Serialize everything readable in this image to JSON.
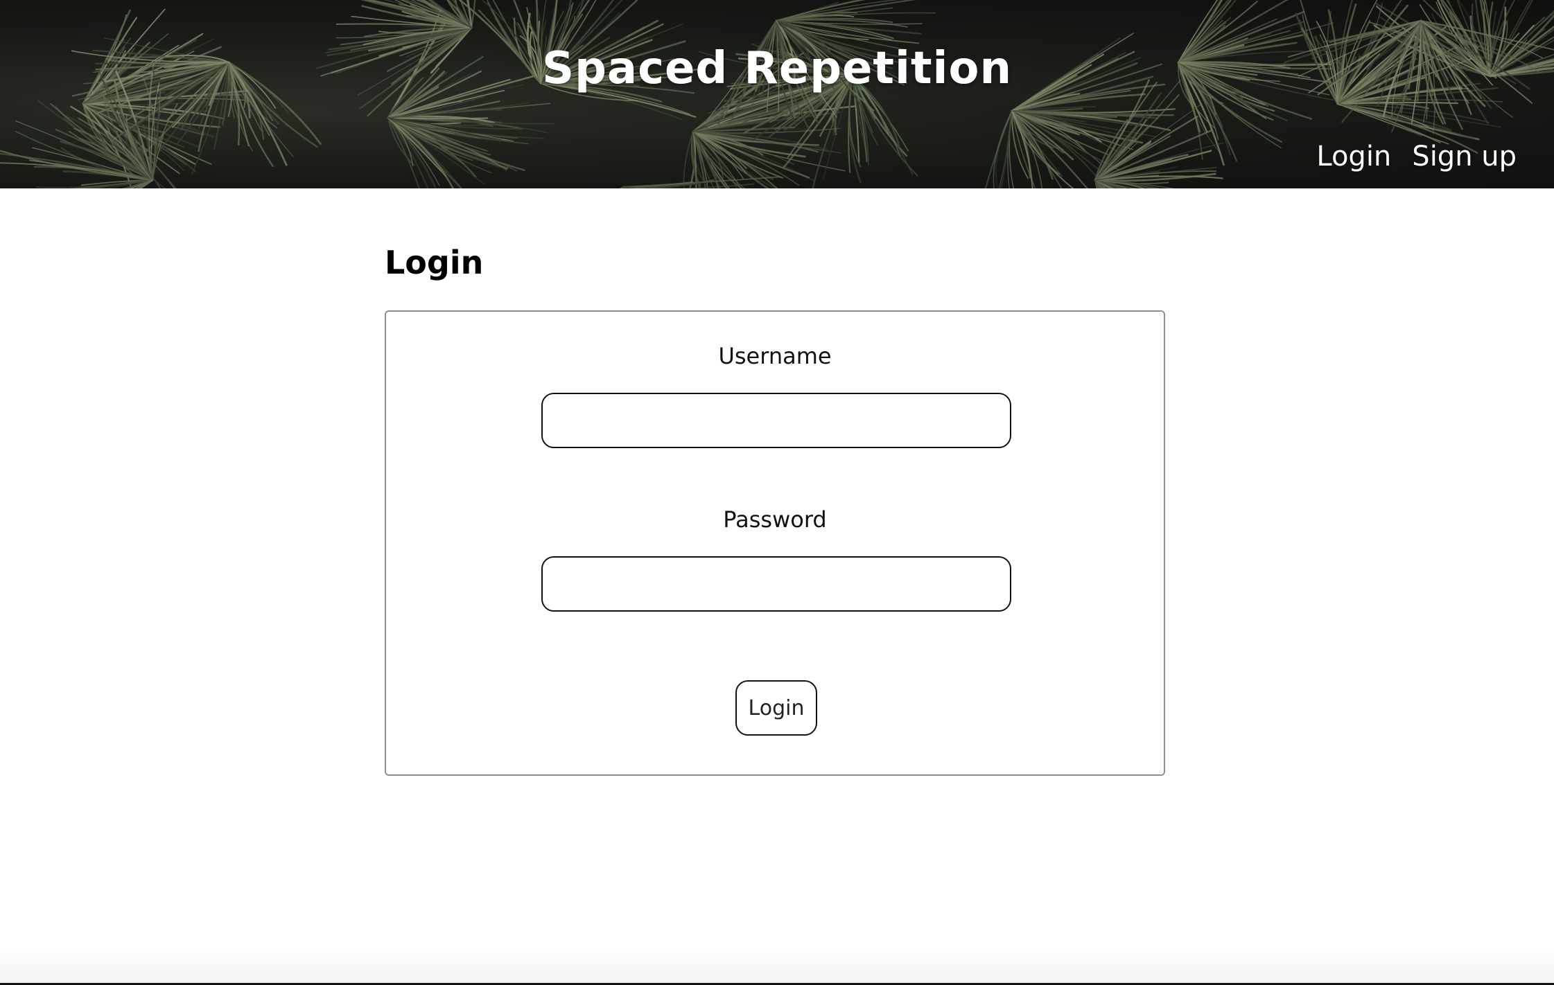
{
  "header": {
    "title": "Spaced Repetition",
    "nav": {
      "login_label": "Login",
      "signup_label": "Sign up"
    },
    "background_image": "pine-needles"
  },
  "main": {
    "heading": "Login",
    "form": {
      "username_label": "Username",
      "username_value": "",
      "password_label": "Password",
      "password_value": "",
      "submit_label": "Login"
    }
  },
  "colors": {
    "header_bg": "#1b1d19",
    "needle": "#6f7d5e",
    "text_on_header": "#ffffff",
    "page_bg": "#ffffff",
    "card_border": "#8f8f8f",
    "input_border": "#111111"
  }
}
